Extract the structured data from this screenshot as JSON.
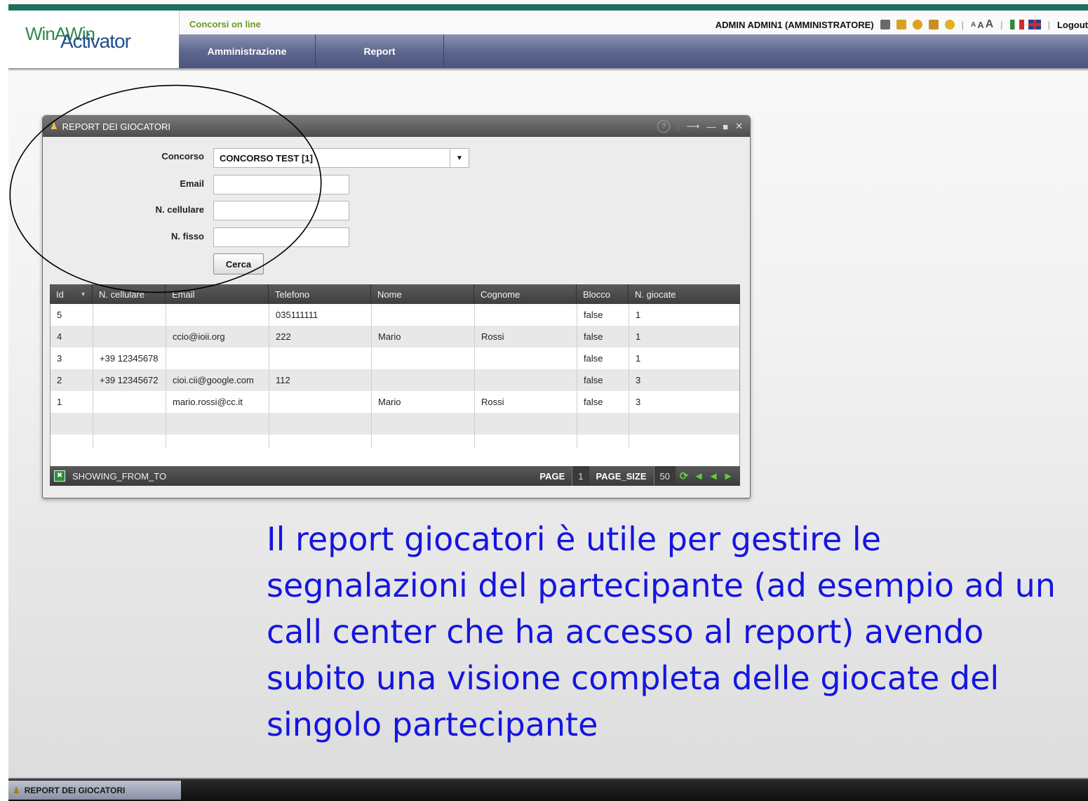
{
  "header": {
    "logo_line1": "WinAWin",
    "logo_line2": "Activator",
    "sublink": "Concorsi on line",
    "user": "ADMIN ADMIN1 (AMMINISTRATORE)",
    "font_sizes": [
      "A",
      "A",
      "A"
    ],
    "logout": "Logout"
  },
  "nav": {
    "tabs": [
      {
        "label": "Amministrazione"
      },
      {
        "label": "Report"
      }
    ]
  },
  "window": {
    "title": "REPORT DEI GIOCATORI",
    "help": "?",
    "form": {
      "concorso_label": "Concorso",
      "concorso_value": "CONCORSO TEST [1]",
      "email_label": "Email",
      "email_value": "",
      "cellulare_label": "N. cellulare",
      "cellulare_value": "",
      "fisso_label": "N. fisso",
      "fisso_value": "",
      "search_button": "Cerca"
    },
    "grid": {
      "columns": [
        "Id",
        "N. cellulare",
        "Email",
        "Telefono",
        "Nome",
        "Cognome",
        "Blocco",
        "N. giocate"
      ],
      "rows": [
        [
          "5",
          "",
          "",
          "035111111",
          "",
          "",
          "false",
          "1"
        ],
        [
          "4",
          "",
          "ccio@ioii.org",
          "222",
          "Mario",
          "Rossi",
          "false",
          "1"
        ],
        [
          "3",
          "+39 12345678",
          "",
          "",
          "",
          "",
          "false",
          "1"
        ],
        [
          "2",
          "+39 12345672",
          "cioi.cii@google.com",
          "112",
          "",
          "",
          "false",
          "3"
        ],
        [
          "1",
          "",
          "mario.rossi@cc.it",
          "",
          "Mario",
          "Rossi",
          "false",
          "3"
        ]
      ],
      "footer_status": "SHOWING_FROM_TO",
      "page_label": "PAGE",
      "page_value": "1",
      "page_size_label": "PAGE_SIZE",
      "page_size_value": "50"
    }
  },
  "description": "Il report giocatori è utile per gestire le segnalazioni del partecipante (ad esempio ad un call center che ha accesso al report) avendo subito una visione completa delle giocate del singolo partecipante",
  "taskbar": {
    "item": "REPORT DEI GIOCATORI"
  },
  "colors": {
    "description_text": "#1515e0",
    "nav_bar": "#5e678e",
    "top_stripe": "#1f6f5e"
  }
}
